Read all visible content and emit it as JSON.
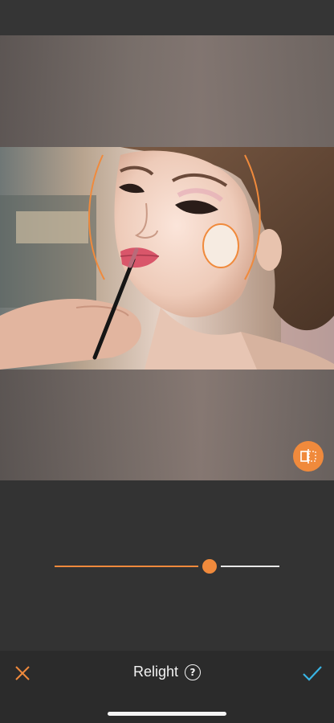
{
  "toolbar": {
    "title": "Relight",
    "help_symbol": "?",
    "cancel_icon": "close-icon",
    "apply_icon": "check-icon"
  },
  "slider": {
    "value_fraction": 0.69
  },
  "compare": {
    "icon": "split-compare-icon"
  },
  "colors": {
    "accent": "#f08a3c",
    "apply": "#39b4e4",
    "background": "#333333"
  }
}
